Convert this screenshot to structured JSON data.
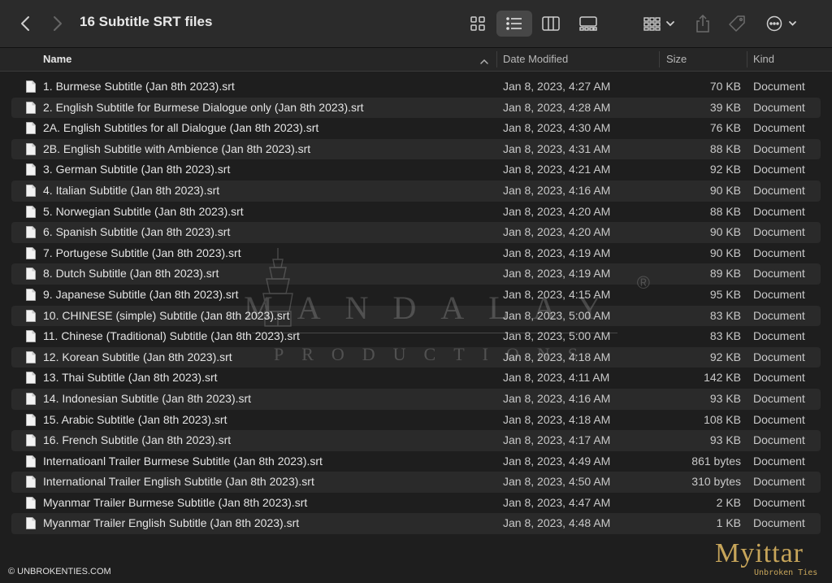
{
  "window": {
    "title": "16 Subtitle SRT files"
  },
  "toolbar": {
    "icons": [
      "back-icon",
      "forward-icon",
      "icon-view-icon",
      "list-view-icon",
      "column-view-icon",
      "gallery-view-icon",
      "group-icon",
      "share-icon",
      "tag-icon",
      "more-icon"
    ]
  },
  "columns": {
    "name": "Name",
    "date": "Date Modified",
    "size": "Size",
    "kind": "Kind"
  },
  "files": [
    {
      "name": "1. Burmese Subtitle (Jan 8th 2023).srt",
      "date": "Jan 8, 2023, 4:27 AM",
      "size": "70 KB",
      "kind": "Document"
    },
    {
      "name": "2. English Subtitle for Burmese Dialogue only (Jan 8th 2023).srt",
      "date": "Jan 8, 2023, 4:28 AM",
      "size": "39 KB",
      "kind": "Document"
    },
    {
      "name": "2A. English Subtitles for all Dialogue (Jan 8th 2023).srt",
      "date": "Jan 8, 2023, 4:30 AM",
      "size": "76 KB",
      "kind": "Document"
    },
    {
      "name": "2B. English Subtitle with Ambience (Jan 8th 2023).srt",
      "date": "Jan 8, 2023, 4:31 AM",
      "size": "88 KB",
      "kind": "Document"
    },
    {
      "name": "3. German Subtitle (Jan 8th 2023).srt",
      "date": "Jan 8, 2023, 4:21 AM",
      "size": "92 KB",
      "kind": "Document"
    },
    {
      "name": "4. Italian Subtitle (Jan 8th 2023).srt",
      "date": "Jan 8, 2023, 4:16 AM",
      "size": "90 KB",
      "kind": "Document"
    },
    {
      "name": "5. Norwegian Subtitle (Jan 8th 2023).srt",
      "date": "Jan 8, 2023, 4:20 AM",
      "size": "88 KB",
      "kind": "Document"
    },
    {
      "name": "6. Spanish Subtitle (Jan 8th 2023).srt",
      "date": "Jan 8, 2023, 4:20 AM",
      "size": "90 KB",
      "kind": "Document"
    },
    {
      "name": "7. Portugese Subtitle (Jan 8th 2023).srt",
      "date": "Jan 8, 2023, 4:19 AM",
      "size": "90 KB",
      "kind": "Document"
    },
    {
      "name": "8. Dutch Subtitle (Jan 8th 2023).srt",
      "date": "Jan 8, 2023, 4:19 AM",
      "size": "89 KB",
      "kind": "Document"
    },
    {
      "name": "9. Japanese Subtitle (Jan 8th 2023).srt",
      "date": "Jan 8, 2023, 4:15 AM",
      "size": "95 KB",
      "kind": "Document"
    },
    {
      "name": "10. CHINESE (simple) Subtitle (Jan 8th 2023).srt",
      "date": "Jan 8, 2023, 5:00 AM",
      "size": "83 KB",
      "kind": "Document"
    },
    {
      "name": "11. Chinese (Traditional) Subtitle (Jan 8th 2023).srt",
      "date": "Jan 8, 2023, 5:00 AM",
      "size": "83 KB",
      "kind": "Document"
    },
    {
      "name": "12. Korean Subtitle (Jan 8th 2023).srt",
      "date": "Jan 8, 2023, 4:18 AM",
      "size": "92 KB",
      "kind": "Document"
    },
    {
      "name": "13. Thai Subtitle (Jan 8th 2023).srt",
      "date": "Jan 8, 2023, 4:11 AM",
      "size": "142 KB",
      "kind": "Document"
    },
    {
      "name": "14. Indonesian Subtitle (Jan 8th 2023).srt",
      "date": "Jan 8, 2023, 4:16 AM",
      "size": "93 KB",
      "kind": "Document"
    },
    {
      "name": "15. Arabic Subtitle (Jan 8th 2023).srt",
      "date": "Jan 8, 2023, 4:18 AM",
      "size": "108 KB",
      "kind": "Document"
    },
    {
      "name": "16. French Subtitle (Jan 8th 2023).srt",
      "date": "Jan 8, 2023, 4:17 AM",
      "size": "93 KB",
      "kind": "Document"
    },
    {
      "name": "Internatioanl Trailer Burmese Subtitle (Jan 8th 2023).srt",
      "date": "Jan 8, 2023, 4:49 AM",
      "size": "861 bytes",
      "kind": "Document"
    },
    {
      "name": "International Trailer English Subtitle (Jan 8th 2023).srt",
      "date": "Jan 8, 2023, 4:50 AM",
      "size": "310 bytes",
      "kind": "Document"
    },
    {
      "name": "Myanmar Trailer Burmese Subtitle (Jan 8th 2023).srt",
      "date": "Jan 8, 2023, 4:47 AM",
      "size": "2 KB",
      "kind": "Document"
    },
    {
      "name": "Myanmar Trailer English Subtitle (Jan 8th 2023).srt",
      "date": "Jan 8, 2023, 4:48 AM",
      "size": "1 KB",
      "kind": "Document"
    }
  ],
  "watermark": {
    "main": "MANDALAY",
    "sub": "PRODUCTIONS",
    "mark": "®"
  },
  "footer": {
    "copyright": "© UNBROKENTIES.COM",
    "brand": "Myittar",
    "brand_tagline": "Unbroken Ties"
  },
  "colors": {
    "background": "#1e1e1e",
    "row_alt": "#2a2a2a",
    "toolbar": "#2b2b2b",
    "brand": "#c7a55a"
  }
}
